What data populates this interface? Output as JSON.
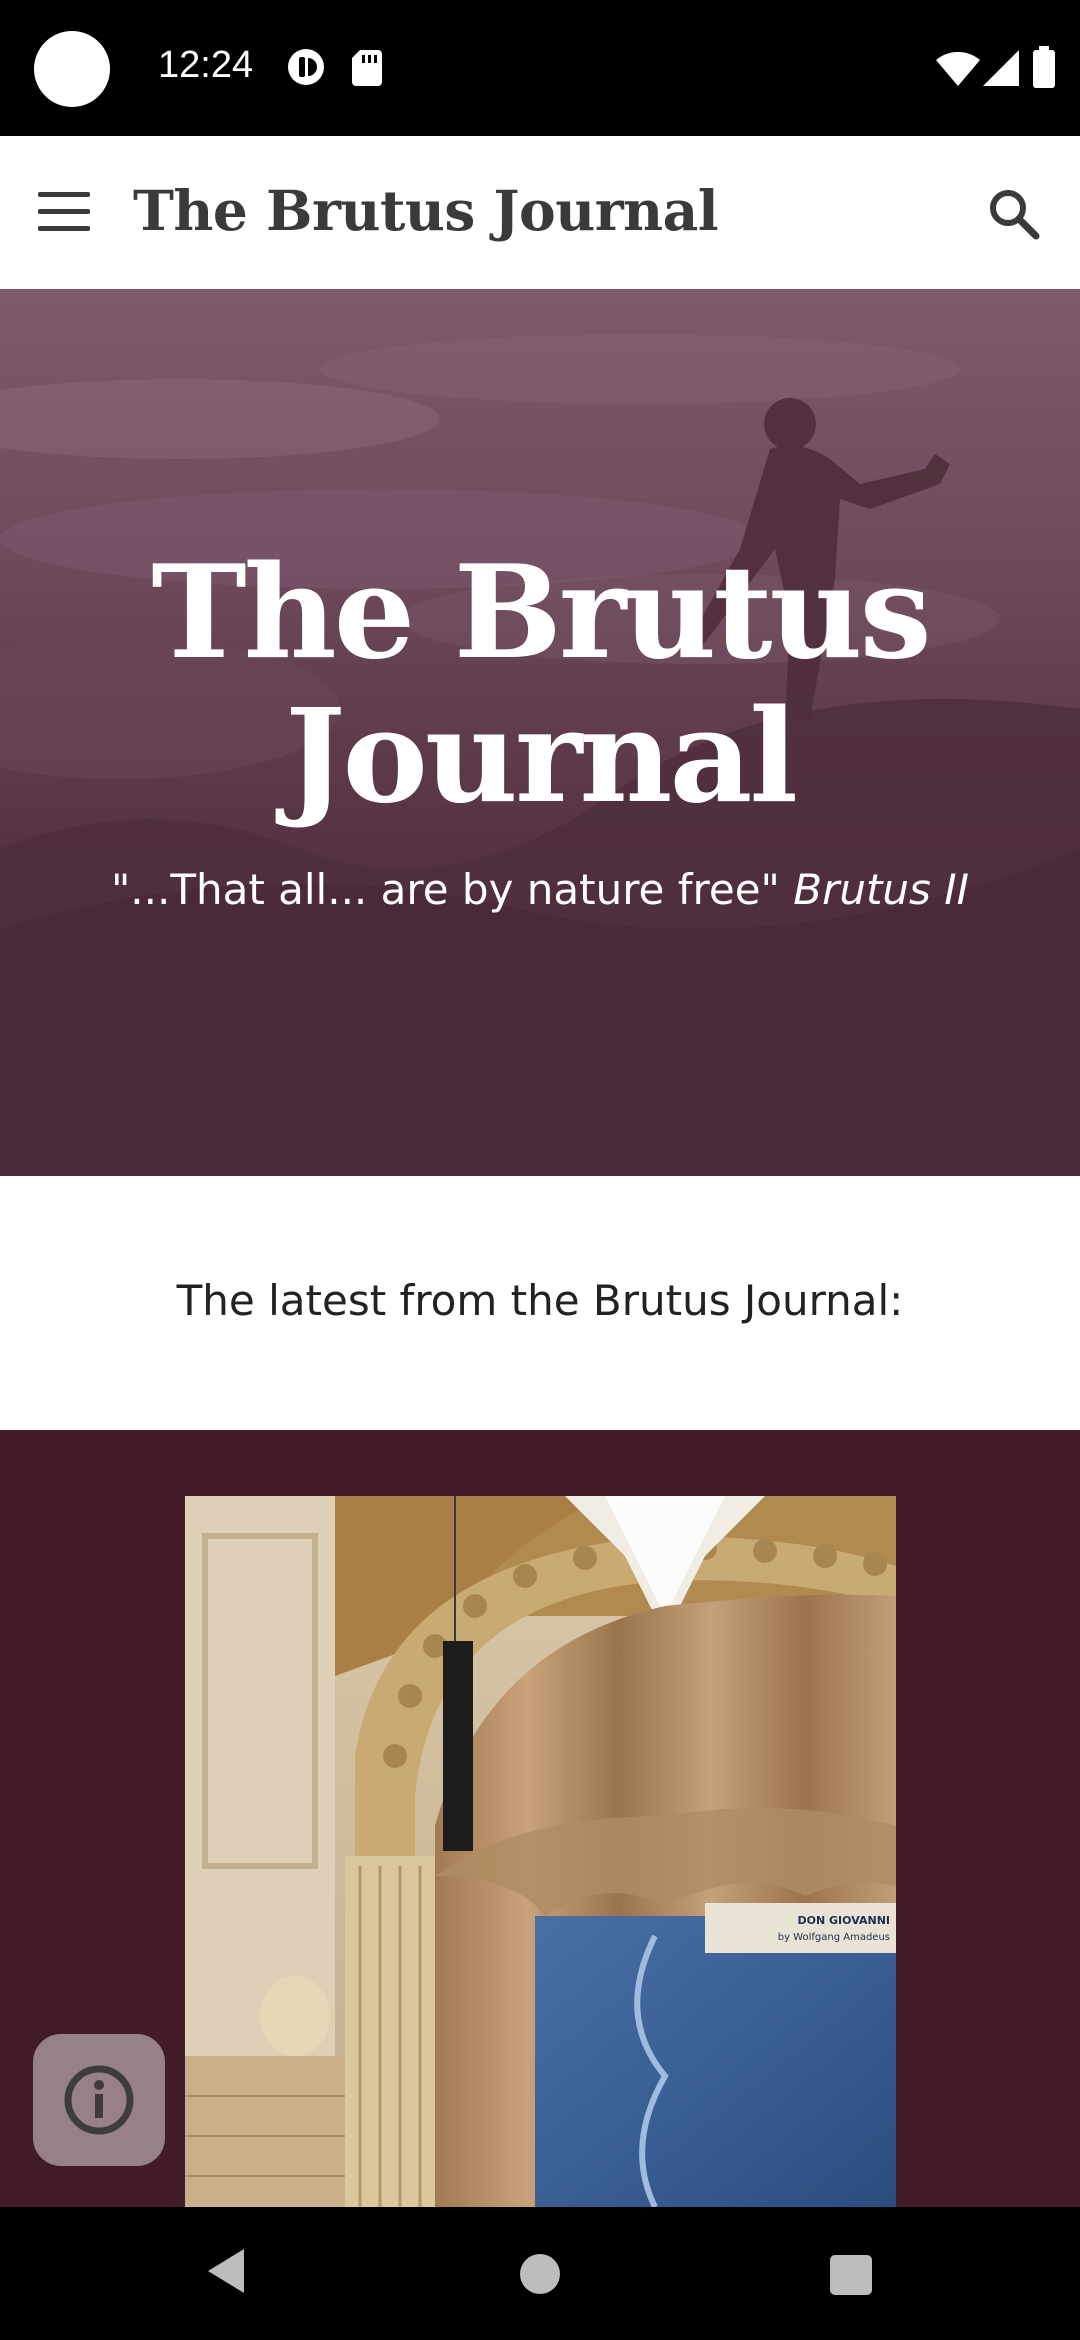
{
  "status_bar": {
    "time": "12:24"
  },
  "app_bar": {
    "title": "The Brutus Journal",
    "menu_icon": "hamburger-menu-icon",
    "search_icon": "search-icon"
  },
  "hero": {
    "title_line1": "The Brutus",
    "title_line2": "Journal",
    "quote": "\"...That all... are by nature free\"",
    "quote_source": "Brutus II"
  },
  "latest": {
    "heading": "The latest from the Brutus Journal:"
  },
  "post_image": {
    "sign_line1": "DON GIOVANNI",
    "sign_line2": "by Wolfgang Amadeus"
  },
  "colors": {
    "hero_bg": "#4a2a39",
    "post_section_bg": "#431c2c",
    "title_text": "#3a3a3a"
  }
}
